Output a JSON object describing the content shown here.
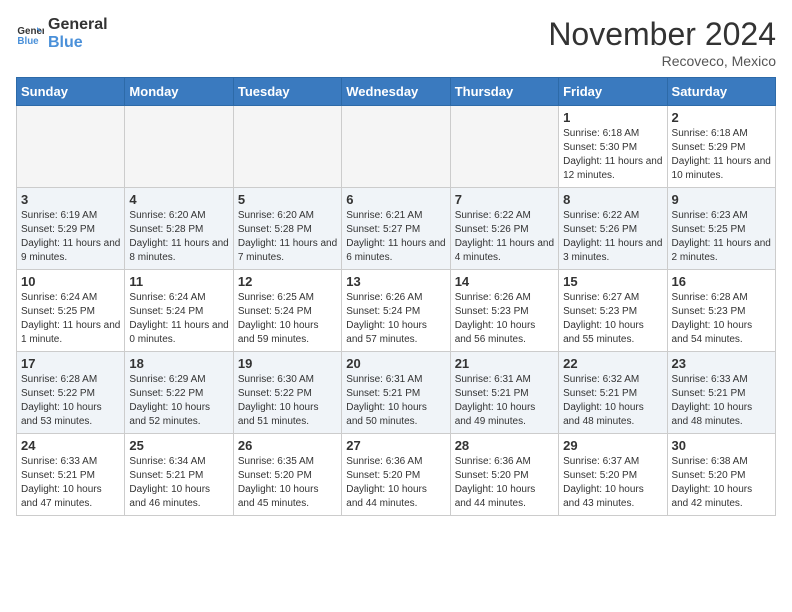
{
  "header": {
    "logo_line1": "General",
    "logo_line2": "Blue",
    "month_title": "November 2024",
    "location": "Recoveco, Mexico"
  },
  "weekdays": [
    "Sunday",
    "Monday",
    "Tuesday",
    "Wednesday",
    "Thursday",
    "Friday",
    "Saturday"
  ],
  "weeks": [
    [
      {
        "day": "",
        "info": ""
      },
      {
        "day": "",
        "info": ""
      },
      {
        "day": "",
        "info": ""
      },
      {
        "day": "",
        "info": ""
      },
      {
        "day": "",
        "info": ""
      },
      {
        "day": "1",
        "info": "Sunrise: 6:18 AM\nSunset: 5:30 PM\nDaylight: 11 hours and 12 minutes."
      },
      {
        "day": "2",
        "info": "Sunrise: 6:18 AM\nSunset: 5:29 PM\nDaylight: 11 hours and 10 minutes."
      }
    ],
    [
      {
        "day": "3",
        "info": "Sunrise: 6:19 AM\nSunset: 5:29 PM\nDaylight: 11 hours and 9 minutes."
      },
      {
        "day": "4",
        "info": "Sunrise: 6:20 AM\nSunset: 5:28 PM\nDaylight: 11 hours and 8 minutes."
      },
      {
        "day": "5",
        "info": "Sunrise: 6:20 AM\nSunset: 5:28 PM\nDaylight: 11 hours and 7 minutes."
      },
      {
        "day": "6",
        "info": "Sunrise: 6:21 AM\nSunset: 5:27 PM\nDaylight: 11 hours and 6 minutes."
      },
      {
        "day": "7",
        "info": "Sunrise: 6:22 AM\nSunset: 5:26 PM\nDaylight: 11 hours and 4 minutes."
      },
      {
        "day": "8",
        "info": "Sunrise: 6:22 AM\nSunset: 5:26 PM\nDaylight: 11 hours and 3 minutes."
      },
      {
        "day": "9",
        "info": "Sunrise: 6:23 AM\nSunset: 5:25 PM\nDaylight: 11 hours and 2 minutes."
      }
    ],
    [
      {
        "day": "10",
        "info": "Sunrise: 6:24 AM\nSunset: 5:25 PM\nDaylight: 11 hours and 1 minute."
      },
      {
        "day": "11",
        "info": "Sunrise: 6:24 AM\nSunset: 5:24 PM\nDaylight: 11 hours and 0 minutes."
      },
      {
        "day": "12",
        "info": "Sunrise: 6:25 AM\nSunset: 5:24 PM\nDaylight: 10 hours and 59 minutes."
      },
      {
        "day": "13",
        "info": "Sunrise: 6:26 AM\nSunset: 5:24 PM\nDaylight: 10 hours and 57 minutes."
      },
      {
        "day": "14",
        "info": "Sunrise: 6:26 AM\nSunset: 5:23 PM\nDaylight: 10 hours and 56 minutes."
      },
      {
        "day": "15",
        "info": "Sunrise: 6:27 AM\nSunset: 5:23 PM\nDaylight: 10 hours and 55 minutes."
      },
      {
        "day": "16",
        "info": "Sunrise: 6:28 AM\nSunset: 5:23 PM\nDaylight: 10 hours and 54 minutes."
      }
    ],
    [
      {
        "day": "17",
        "info": "Sunrise: 6:28 AM\nSunset: 5:22 PM\nDaylight: 10 hours and 53 minutes."
      },
      {
        "day": "18",
        "info": "Sunrise: 6:29 AM\nSunset: 5:22 PM\nDaylight: 10 hours and 52 minutes."
      },
      {
        "day": "19",
        "info": "Sunrise: 6:30 AM\nSunset: 5:22 PM\nDaylight: 10 hours and 51 minutes."
      },
      {
        "day": "20",
        "info": "Sunrise: 6:31 AM\nSunset: 5:21 PM\nDaylight: 10 hours and 50 minutes."
      },
      {
        "day": "21",
        "info": "Sunrise: 6:31 AM\nSunset: 5:21 PM\nDaylight: 10 hours and 49 minutes."
      },
      {
        "day": "22",
        "info": "Sunrise: 6:32 AM\nSunset: 5:21 PM\nDaylight: 10 hours and 48 minutes."
      },
      {
        "day": "23",
        "info": "Sunrise: 6:33 AM\nSunset: 5:21 PM\nDaylight: 10 hours and 48 minutes."
      }
    ],
    [
      {
        "day": "24",
        "info": "Sunrise: 6:33 AM\nSunset: 5:21 PM\nDaylight: 10 hours and 47 minutes."
      },
      {
        "day": "25",
        "info": "Sunrise: 6:34 AM\nSunset: 5:21 PM\nDaylight: 10 hours and 46 minutes."
      },
      {
        "day": "26",
        "info": "Sunrise: 6:35 AM\nSunset: 5:20 PM\nDaylight: 10 hours and 45 minutes."
      },
      {
        "day": "27",
        "info": "Sunrise: 6:36 AM\nSunset: 5:20 PM\nDaylight: 10 hours and 44 minutes."
      },
      {
        "day": "28",
        "info": "Sunrise: 6:36 AM\nSunset: 5:20 PM\nDaylight: 10 hours and 44 minutes."
      },
      {
        "day": "29",
        "info": "Sunrise: 6:37 AM\nSunset: 5:20 PM\nDaylight: 10 hours and 43 minutes."
      },
      {
        "day": "30",
        "info": "Sunrise: 6:38 AM\nSunset: 5:20 PM\nDaylight: 10 hours and 42 minutes."
      }
    ]
  ]
}
